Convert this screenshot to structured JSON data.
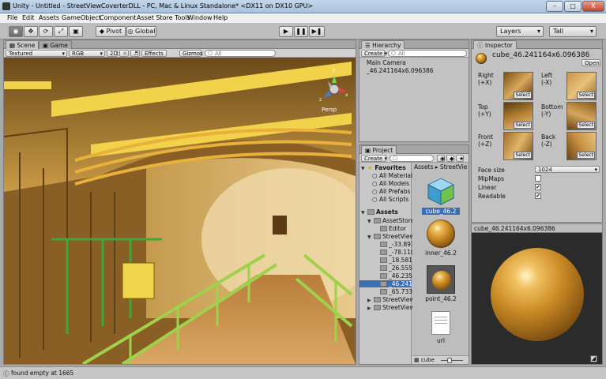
{
  "window": {
    "title": "Unity - Untitled - StreetViewCoverterDLL - PC, Mac & Linux Standalone* <DX11 on DX10 GPU>",
    "min": "–",
    "max": "□",
    "close": "X"
  },
  "menu": [
    "File",
    "Edit",
    "Assets",
    "GameObject",
    "Component",
    "Asset Store Tools",
    "Window",
    "Help"
  ],
  "toolbar": {
    "pivot": "Pivot",
    "global": "Global",
    "layers": "Layers",
    "layout": "Tall",
    "play": "▶",
    "pause": "❚❚",
    "step": "▶❚"
  },
  "scene": {
    "tabs": [
      "Scene",
      "Game"
    ],
    "shading": "Textured",
    "rgb": "RGB",
    "mode2d": "2D",
    "effects": "Effects",
    "gizmos": "Gizmos",
    "search_placeholder": "All",
    "persp": "Persp",
    "gizmo_y": "y",
    "gizmo_x": "x",
    "gizmo_z": "z"
  },
  "hierarchy": {
    "tab": "Hierarchy",
    "create": "Create",
    "search_placeholder": "All",
    "items": [
      "Main Camera",
      "_46.241164x6.096386"
    ]
  },
  "project": {
    "tab": "Project",
    "create": "Create",
    "favorites_label": "Favorites",
    "favorites": [
      "All Material",
      "All Models",
      "All Prefabs",
      "All Scripts"
    ],
    "assets_label": "Assets",
    "tree": [
      "AssetStore",
      "Editor",
      "StreetView",
      "_-33.893",
      "_-78.110",
      "_18.5812",
      "_26.5551",
      "_46.2358",
      "_46.2411",
      "_65.7338",
      "StreetView",
      "StreetView"
    ],
    "breadcrumb": [
      "Assets",
      "StreetVie"
    ],
    "assets": [
      "cube_46.2",
      "inner_46.2",
      "point_46.2",
      "url"
    ],
    "bottom_label": "cube"
  },
  "inspector": {
    "tab": "Inspector",
    "name": "cube_46.241164x6.096386",
    "open": "Open",
    "faces": [
      {
        "label": "Right\n(+X)",
        "select": "Select"
      },
      {
        "label": "Left\n(-X)",
        "select": "Select"
      },
      {
        "label": "Top\n(+Y)",
        "select": "Select"
      },
      {
        "label": "Bottom\n(-Y)",
        "select": "Select"
      },
      {
        "label": "Front\n(+Z)",
        "select": "Select"
      },
      {
        "label": "Back\n(-Z)",
        "select": "Select"
      }
    ],
    "face_size_label": "Face size",
    "face_size_value": "1024",
    "mipmaps_label": "MipMaps",
    "mipmaps": false,
    "linear_label": "Linear",
    "linear": true,
    "readable_label": "Readable",
    "readable": true,
    "preview_title": "cube_46.241164x6.096386",
    "check": "✔"
  },
  "status": {
    "message": "found empty at 1665"
  },
  "colors": {
    "accent_selection": "#3a6fb5",
    "panel": "#c2c2c2",
    "scene_floor": "#c9964a"
  }
}
